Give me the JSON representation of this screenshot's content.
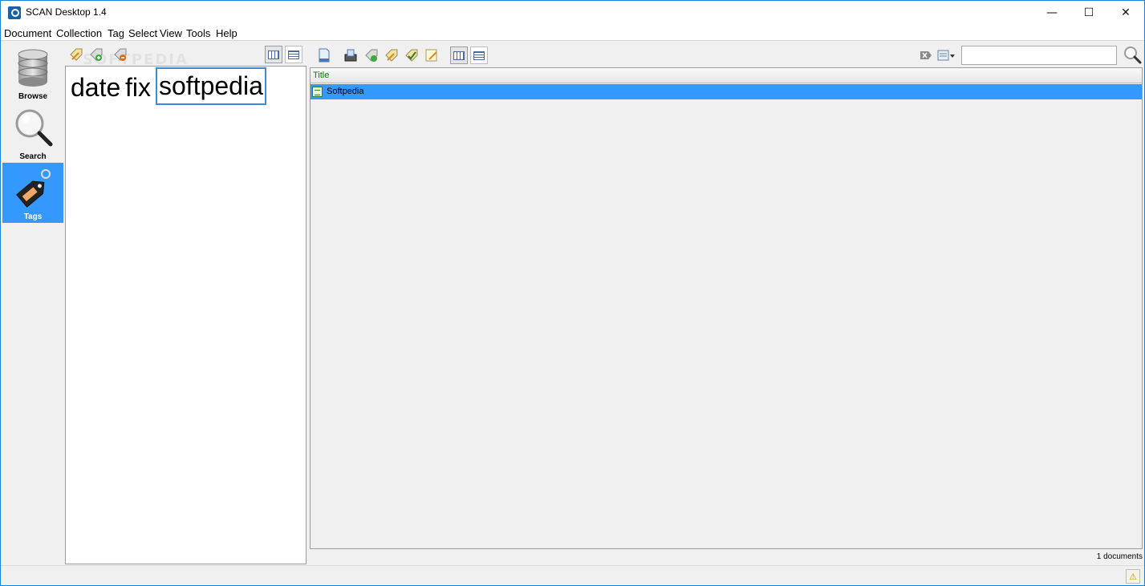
{
  "window": {
    "title": "SCAN Desktop 1.4",
    "controls": [
      "—",
      "☐",
      "✕"
    ]
  },
  "menu": [
    "Document",
    "Collection",
    "Tag",
    "Select",
    "View",
    "Tools",
    "Help"
  ],
  "watermark": "SOFTPEDIA",
  "nav": [
    {
      "label": "Browse",
      "icon": "database-icon",
      "active": false
    },
    {
      "label": "Search",
      "icon": "magnifier-icon",
      "active": false
    },
    {
      "label": "Tags",
      "icon": "tag-icon",
      "active": true
    }
  ],
  "tag_toolbar": {
    "icons": [
      "new-tag-icon",
      "add-tag-icon",
      "remove-tag-icon"
    ]
  },
  "tag_cloud": {
    "words": [
      "date",
      "fix",
      "softpedia"
    ],
    "selected": "softpedia"
  },
  "doc_toolbar": {
    "icons": [
      "new-document-icon",
      "scan-document-icon",
      "add-tag-to-doc-icon",
      "edit-tag-icon",
      "apply-tag-icon",
      "edit-document-icon"
    ],
    "search_placeholder": ""
  },
  "doc_list": {
    "columns": [
      "Title"
    ],
    "rows": [
      {
        "title": "Softpedia"
      }
    ],
    "count_text": "1 documents"
  },
  "colors": {
    "selection": "#3399ff",
    "header_text": "#008000"
  }
}
